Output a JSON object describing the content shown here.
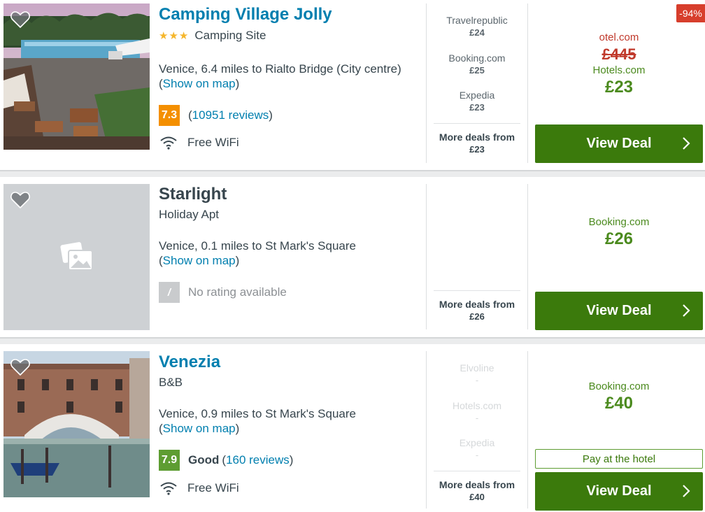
{
  "hotels": [
    {
      "name": "Camping Village Jolly",
      "stars": "★★★",
      "type": "Camping Site",
      "location": "Venice, 6.4 miles to Rialto Bridge (City centre)",
      "show_on_map": "Show on map",
      "rating": "7.3",
      "reviews": "10951 reviews",
      "amenity": "Free WiFi",
      "deals": [
        {
          "provider": "Travelrepublic",
          "price": "£24"
        },
        {
          "provider": "Booking.com",
          "price": "£25"
        },
        {
          "provider": "Expedia",
          "price": "£23"
        }
      ],
      "more_deals_label": "More deals from",
      "more_deals_price": "£23",
      "discount": "-94%",
      "best_struck_provider": "otel.com",
      "best_struck_price": "£445",
      "best_provider": "Hotels.com",
      "best_price": "£23",
      "cta": "View Deal"
    },
    {
      "name": "Starlight",
      "type": "Holiday Apt",
      "location": "Venice, 0.1 miles to St Mark's Square",
      "show_on_map": "Show on map",
      "rating": "/",
      "rating_text": "No rating available",
      "more_deals_label": "More deals from",
      "more_deals_price": "£26",
      "best_provider": "Booking.com",
      "best_price": "£26",
      "cta": "View Deal"
    },
    {
      "name": "Venezia",
      "type": "B&B",
      "location": "Venice, 0.9 miles to St Mark's Square",
      "show_on_map": "Show on map",
      "rating": "7.9",
      "rating_word": "Good",
      "reviews": "160 reviews",
      "amenity": "Free WiFi",
      "deals": [
        {
          "provider": "Elvoline",
          "price": "-"
        },
        {
          "provider": "Hotels.com",
          "price": "-"
        },
        {
          "provider": "Expedia",
          "price": "-"
        }
      ],
      "more_deals_label": "More deals from",
      "more_deals_price": "£40",
      "best_provider": "Booking.com",
      "best_price": "£40",
      "pay_at_hotel": "Pay at the hotel",
      "cta": "View Deal"
    }
  ],
  "colors": {
    "link": "#007faf",
    "cta": "#3b7a0c",
    "price": "#4b8a1e",
    "rating_orange": "#f48f00",
    "rating_green": "#5e9d32",
    "discount": "#d73e2c"
  }
}
